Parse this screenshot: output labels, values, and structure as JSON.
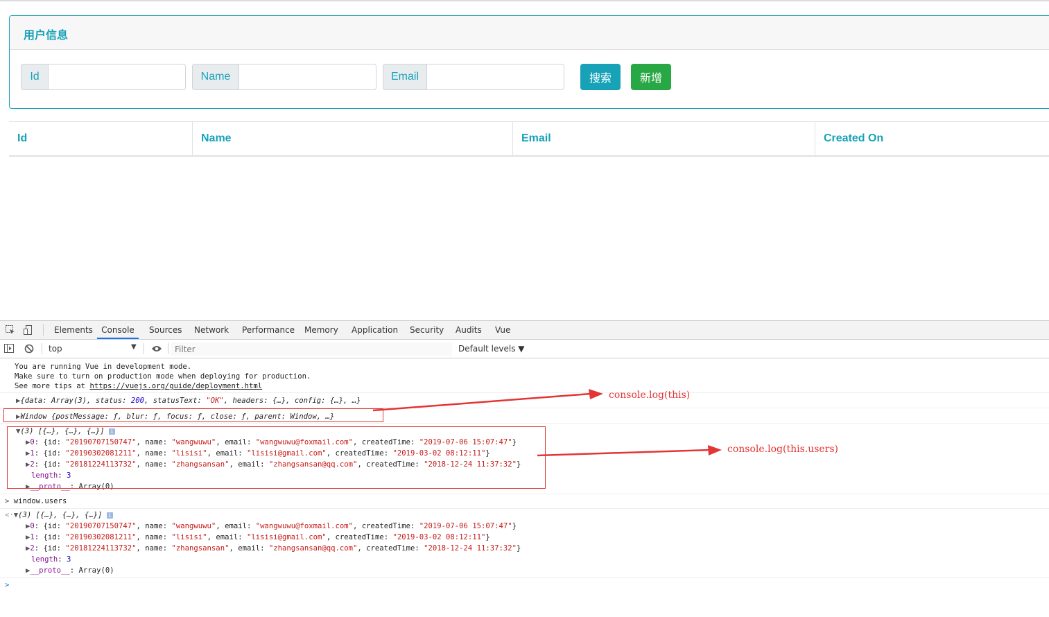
{
  "card": {
    "title": "用户信息",
    "fields": [
      {
        "label": "Id",
        "value": "",
        "placeholder": ""
      },
      {
        "label": "Name",
        "value": "",
        "placeholder": ""
      },
      {
        "label": "Email",
        "value": "",
        "placeholder": ""
      }
    ],
    "search_label": "搜索",
    "add_label": "新增"
  },
  "table": {
    "headers": [
      "Id",
      "Name",
      "Email",
      "Created On"
    ]
  },
  "devtools": {
    "tabs": [
      "Elements",
      "Console",
      "Sources",
      "Network",
      "Performance",
      "Memory",
      "Application",
      "Security",
      "Audits",
      "Vue"
    ],
    "active_tab": "Console",
    "context": "top",
    "filter_placeholder": "Filter",
    "levels": "Default levels ▼"
  },
  "console": {
    "vue_msg": [
      "You are running Vue in development mode.",
      "Make sure to turn on production mode when deploying for production.",
      "See more tips at "
    ],
    "vue_link": "https://vuejs.org/guide/deployment.html",
    "response_prefix": "{data: Array(3), status: ",
    "response_status": "200",
    "response_mid": ", statusText: ",
    "response_status_text": "\"OK\"",
    "response_suffix": ", headers: {…}, config: {…}, …}",
    "window_line": "Window {postMessage: ƒ, blur: ƒ, focus: ƒ, close: ƒ, parent: Window, …}",
    "array_summary": "(3) [{…}, {…}, {…}]",
    "users": [
      {
        "index": "0",
        "id": "\"20190707150747\"",
        "name": "\"wangwuwu\"",
        "email": "\"wangwuwu@foxmail.com\"",
        "createdTime": "\"2019-07-06 15:07:47\""
      },
      {
        "index": "1",
        "id": "\"20190302081211\"",
        "name": "\"lisisi\"",
        "email": "\"lisisi@gmail.com\"",
        "createdTime": "\"2019-03-02 08:12:11\""
      },
      {
        "index": "2",
        "id": "\"20181224113732\"",
        "name": "\"zhangsansan\"",
        "email": "\"zhangsansan@qq.com\"",
        "createdTime": "\"2018-12-24 11:37:32\""
      }
    ],
    "length_key": "length",
    "length_value": "3",
    "proto_key": "__proto__",
    "proto_value": ": Array(0)",
    "input_cmd": "window.users"
  },
  "annotations": {
    "this_label": "console.log(this)",
    "users_label": "console.log(this.users)"
  },
  "colors": {
    "accent": "#17a2b8",
    "success": "#28a745",
    "annotation": "#e23535"
  }
}
